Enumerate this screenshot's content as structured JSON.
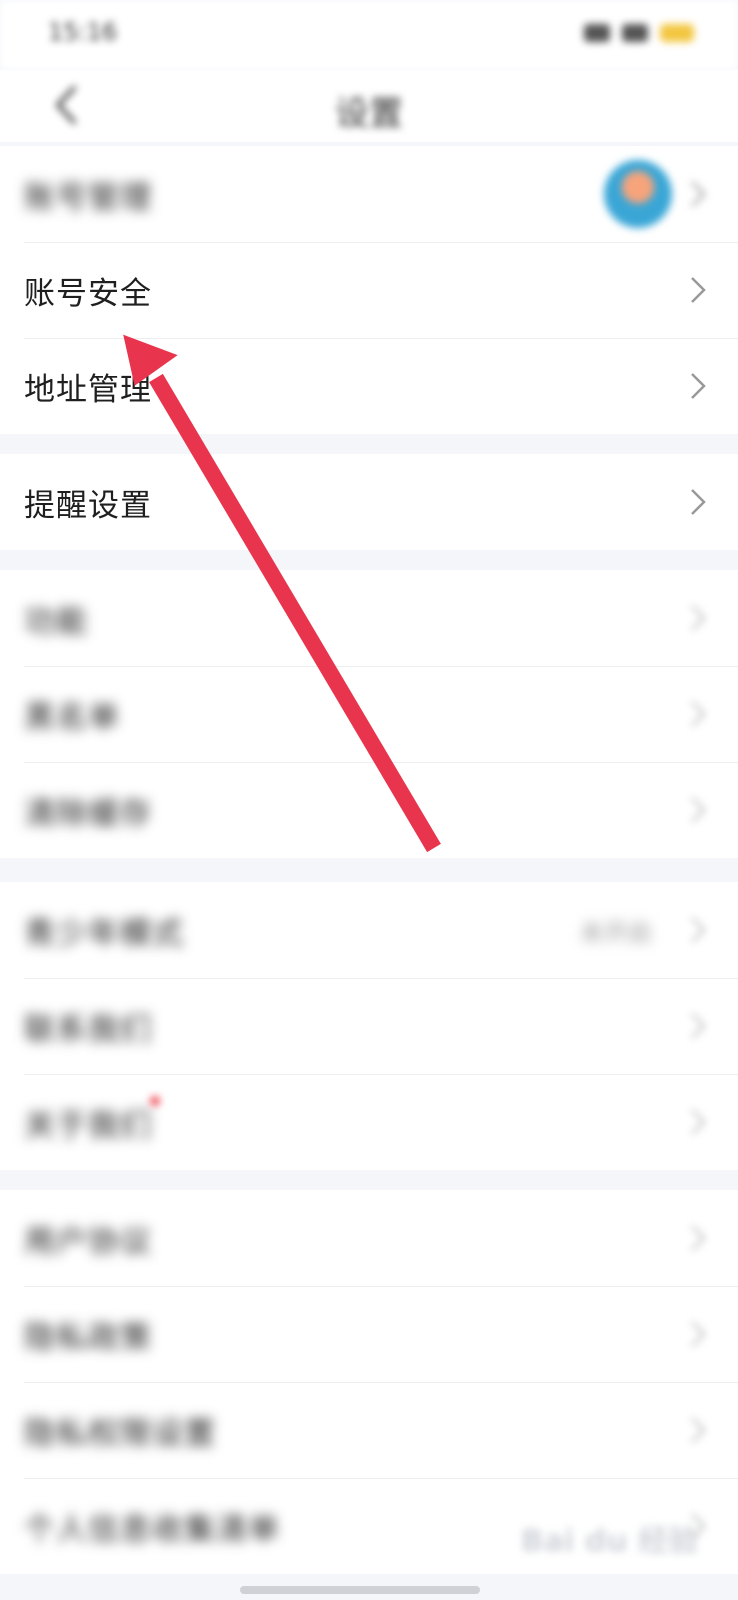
{
  "status_bar": {
    "time": "15:16"
  },
  "header": {
    "title": "设置"
  },
  "groups": [
    {
      "items": [
        {
          "label": "账号管理",
          "blurred": true,
          "has_avatar": true
        },
        {
          "label": "账号安全",
          "blurred": false
        },
        {
          "label": "地址管理",
          "blurred": false
        }
      ]
    },
    {
      "items": [
        {
          "label": "提醒设置",
          "blurred": false
        }
      ]
    },
    {
      "items": [
        {
          "label": "功能",
          "blurred": true
        },
        {
          "label": "黑名单",
          "blurred": true
        },
        {
          "label": "清除缓存",
          "blurred": true
        }
      ]
    },
    {
      "items": [
        {
          "label": "青少年模式",
          "value": "未开启",
          "blurred": true
        },
        {
          "label": "联系我们",
          "blurred": true
        },
        {
          "label": "关于我们",
          "blurred": true,
          "badge": "red-dot"
        }
      ]
    },
    {
      "items": [
        {
          "label": "用户协议",
          "blurred": true
        },
        {
          "label": "隐私政策",
          "blurred": true
        },
        {
          "label": "隐私权限设置",
          "blurred": true
        },
        {
          "label": "个人信息收集清单",
          "blurred": true
        }
      ]
    }
  ],
  "annotation": {
    "type": "arrow",
    "color": "#e8354d"
  },
  "watermark": {
    "text": "Bai du 经验"
  },
  "icons": {
    "back": "back-chevron-icon",
    "row": "chevron-right-icon"
  },
  "colors": {
    "background": "#f5f6fa",
    "card": "#ffffff",
    "arrow": "#e8354d"
  }
}
